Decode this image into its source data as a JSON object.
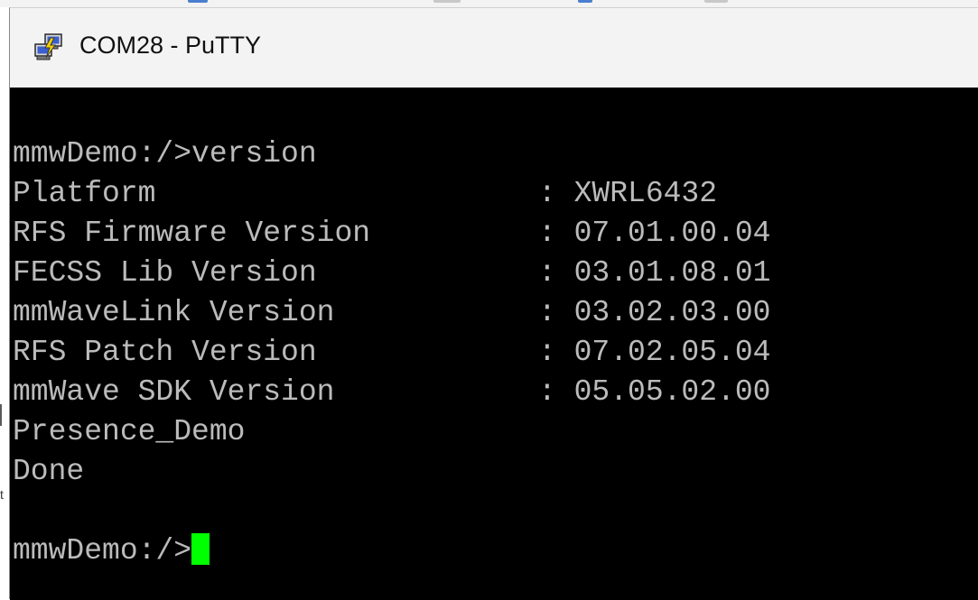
{
  "window": {
    "title": "COM28 - PuTTY",
    "icon": "putty-icon"
  },
  "terminal": {
    "command_line": "mmwDemo:/>version",
    "version_rows": [
      {
        "label": "Platform",
        "sep": ": ",
        "value": "XWRL6432"
      },
      {
        "label": "RFS Firmware Version",
        "sep": ": ",
        "value": "07.01.00.04"
      },
      {
        "label": "FECSS Lib Version",
        "sep": ": ",
        "value": "03.01.08.01"
      },
      {
        "label": "mmWaveLink Version",
        "sep": ": ",
        "value": "03.02.03.00"
      },
      {
        "label": "RFS Patch Version",
        "sep": ": ",
        "value": "07.02.05.04"
      },
      {
        "label": "mmWave SDK Version",
        "sep": ": ",
        "value": "05.05.02.00"
      }
    ],
    "demo_line": "Presence_Demo",
    "done_line": "Done",
    "prompt": "mmwDemo:/>"
  },
  "colors": {
    "terminal_bg": "#000000",
    "terminal_text": "#bbbbbb",
    "cursor": "#00ff00",
    "titlebar_bg": "#f3f3f3"
  },
  "background_edge_char": "t"
}
